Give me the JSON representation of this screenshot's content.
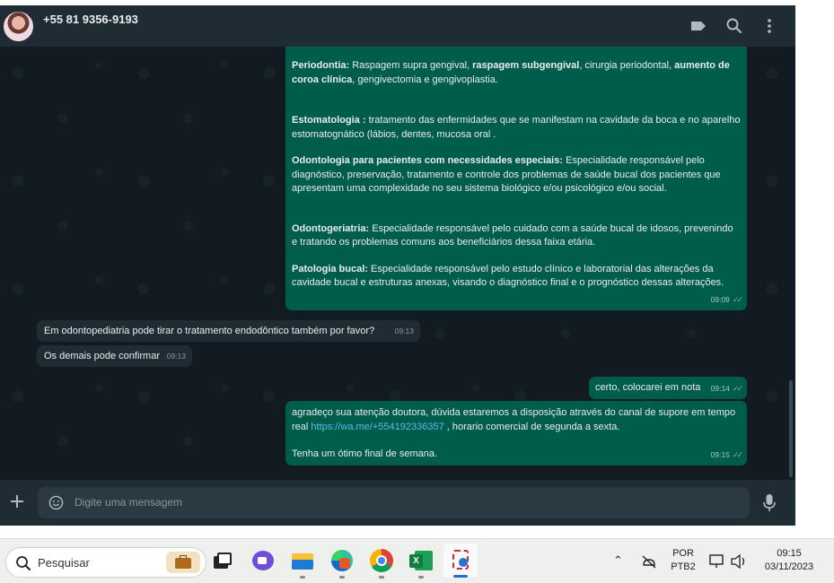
{
  "header": {
    "contact_name": "+55 81 9356-9193",
    "icons": [
      "label-icon",
      "search-icon",
      "menu-icon"
    ]
  },
  "messages": {
    "m1": {
      "direction": "outgoing",
      "p1_term": "Periodontia:",
      "p1_a": " Raspagem supra gengival, ",
      "p1_b": "raspagem subgengival",
      "p1_c": ", cirurgia periodontal, ",
      "p1_d": "aumento de coroa clínica",
      "p1_e": ", gengivectomia e gengivoplastia.",
      "p2_term": "Estomatologia :",
      "p2_text": "  tratamento das enfermidades que se manifestam na cavidade da boca e no aparelho estomatognático (lábios, dentes, mucosa oral .",
      "p3_term": "Odontologia para pacientes com necessidades especiais:",
      "p3_text": " Especialidade responsável pelo diagnóstico, preservação, tratamento e controle dos problemas de saúde bucal dos pacientes que apresentam uma complexidade no seu sistema biológico e/ou psicológico e/ou social.",
      "p4_term": "Odontogeriatria:",
      "p4_text": " Especialidade responsável pelo cuidado com a saúde bucal de idosos, prevenindo e tratando os problemas comuns aos beneficiários dessa faixa etária.",
      "p5_term": "Patologia bucal:",
      "p5_text": " Especialidade responsável pelo estudo clínico e laboratorial das alterações da cavidade bucal e estruturas anexas, visando o diagnóstico final e o prognóstico dessas alterações.",
      "time": "09:09"
    },
    "m2": {
      "direction": "incoming",
      "text": "Em odontopediatria pode tirar o tratamento endodôntico também por favor?",
      "time": "09:13"
    },
    "m3": {
      "direction": "incoming",
      "text": "Os demais pode confirmar",
      "time": "09:13"
    },
    "m4": {
      "direction": "outgoing",
      "text": "certo, colocarei em nota",
      "time": "09:14"
    },
    "m5": {
      "direction": "outgoing",
      "text_a": "agradeço sua atenção doutora, dúvida estaremos  a disposição através do canal de supore em tempo real ",
      "link": "https://wa.me/+554192336357",
      "text_b": " , horario comercial de segunda a sexta.",
      "text_c": "Tenha um ótimo final de semana.",
      "time": "09:15"
    }
  },
  "composer": {
    "placeholder": "Digite uma mensagem"
  },
  "taskbar": {
    "search_label": "Pesquisar",
    "apps": [
      "briefcase-icon",
      "task-view-icon",
      "teams-icon",
      "file-explorer-icon",
      "edge-icon",
      "chrome-icon",
      "excel-icon",
      "snipping-tool-icon"
    ],
    "language_top": "POR",
    "language_bottom": "PTB2",
    "time": "09:15",
    "date": "03/11/2023"
  },
  "colors": {
    "outgoing_bubble": "#005c4b",
    "incoming_bubble": "#202c33",
    "background": "#111b21",
    "link": "#53bdeb"
  }
}
